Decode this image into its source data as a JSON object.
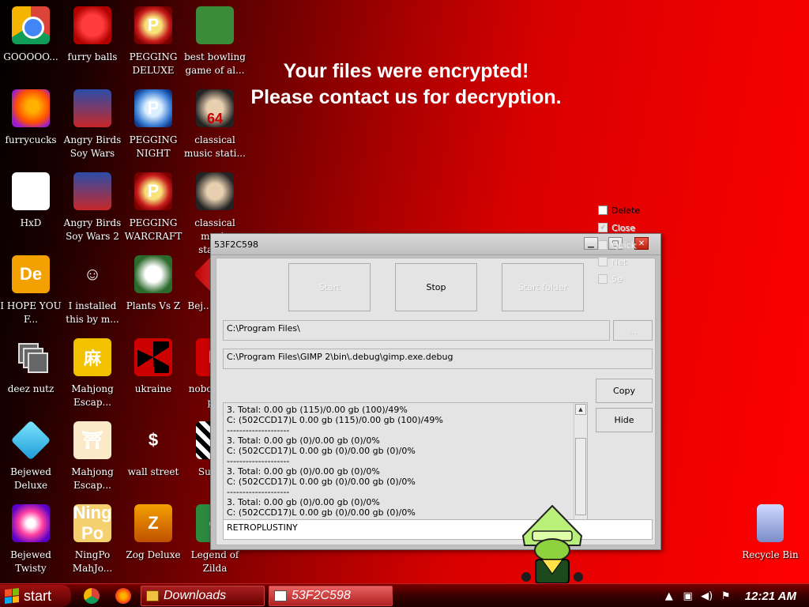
{
  "banner": {
    "line1": "Your files were encrypted!",
    "line2": "Please contact us for decryption."
  },
  "desktop_icons": [
    {
      "label": "GOOOOO...",
      "icon": "chrome-icon"
    },
    {
      "label": "furry balls",
      "icon": "fuzzy-ball-icon"
    },
    {
      "label": "PEGGING DELUXE",
      "icon": "pegging-icon",
      "glyph": "P"
    },
    {
      "label": "best bowling game of al...",
      "icon": "bowling-icon"
    },
    {
      "label": "furrycucks",
      "icon": "firefox-icon"
    },
    {
      "label": "Angry Birds Soy Wars",
      "icon": "angry-birds-icon"
    },
    {
      "label": "PEGGING NIGHT",
      "icon": "pegging-icon",
      "glyph": "P"
    },
    {
      "label": "classical music stati...",
      "icon": "portrait-icon",
      "glyph": "64"
    },
    {
      "label": "HxD",
      "icon": "hxd-icon",
      "glyph": "HxD"
    },
    {
      "label": "Angry Birds Soy Wars 2",
      "icon": "angry-birds-icon"
    },
    {
      "label": "PEGGING WARCRAFT",
      "icon": "pegging-icon",
      "glyph": "P"
    },
    {
      "label": "classical music station",
      "icon": "portrait-icon"
    },
    {
      "label": "I HOPE YOU F...",
      "icon": "de-icon",
      "glyph": "De"
    },
    {
      "label": "I installed this by m...",
      "icon": "running-man-icon",
      "glyph": "☺"
    },
    {
      "label": "Plants Vs Z",
      "icon": "flower-icon"
    },
    {
      "label": "Bej... The...",
      "icon": "jewel-icon"
    },
    {
      "label": "deez nutz",
      "icon": "windows-stack-icon"
    },
    {
      "label": "Mahjong Escap...",
      "icon": "mahjong-icon",
      "glyph": "麻"
    },
    {
      "label": "ukraine",
      "icon": "radiation-icon"
    },
    {
      "label": "nobo... can p...",
      "icon": "nobody-icon",
      "glyph": "D"
    },
    {
      "label": "Bejewed Deluxe",
      "icon": "diamond-icon"
    },
    {
      "label": "Mahjong Escap...",
      "icon": "torii-icon",
      "glyph": "⛩"
    },
    {
      "label": "wall street",
      "icon": "money-bag-icon",
      "glyph": "$"
    },
    {
      "label": "Supe...",
      "icon": "checker-icon"
    },
    {
      "label": "Bejewed Twisty",
      "icon": "twisty-gem-icon"
    },
    {
      "label": "NingPo MahJo...",
      "icon": "ningpo-icon",
      "glyph": "Ning Po"
    },
    {
      "label": "Zog Deluxe",
      "icon": "zog-icon",
      "glyph": "Z"
    },
    {
      "label": "Legend of Zilda",
      "icon": "link-icon",
      "glyph": "☻"
    }
  ],
  "recycle_bin": {
    "label": "Recycle Bin",
    "icon": "recycle-bin-icon"
  },
  "window": {
    "title": "53F2C598",
    "buttons": {
      "start": "Start",
      "stop": "Stop",
      "start_folder": "Start folder"
    },
    "path_field": "C:\\Program Files\\",
    "browse_label": "...",
    "current_file": "C:\\Program Files\\GIMP 2\\bin\\.debug\\gimp.exe.debug",
    "log_lines": [
      "3. Total: 0.00 gb (115)/0.00 gb (100)/49%",
      "C: (502CCD17)L 0.00 gb (115)/0.00 gb (100)/49%",
      "--------------------",
      "3. Total: 0.00 gb (0)/0.00 gb (0)/0%",
      "C: (502CCD17)L 0.00 gb (0)/0.00 gb (0)/0%",
      "--------------------",
      "3. Total: 0.00 gb (0)/0.00 gb (0)/0%",
      "C: (502CCD17)L 0.00 gb (0)/0.00 gb (0)/0%",
      "--------------------",
      "3. Total: 0.00 gb (0)/0.00 gb (0)/0%",
      "C: (502CCD17)L 0.00 gb (0)/0.00 gb (0)/0%"
    ],
    "side_buttons": {
      "copy": "Copy",
      "hide": "Hide"
    },
    "checkboxes": [
      {
        "label": "Delete",
        "enabled": true,
        "checked": false
      },
      {
        "label": "Close",
        "enabled": false,
        "checked": true
      },
      {
        "label": "Quick",
        "enabled": false,
        "checked": false
      },
      {
        "label": "Net",
        "enabled": false,
        "checked": false
      },
      {
        "label": "5e",
        "enabled": false,
        "checked": false
      }
    ],
    "footer_field": "RETROPLUSTINY"
  },
  "taskbar": {
    "start_label": "start",
    "quick_launch": [
      "chrome-icon",
      "firefox-icon"
    ],
    "tasks": [
      {
        "label": "Downloads",
        "icon": "folder-icon"
      },
      {
        "label": "53F2C598",
        "icon": "window-icon"
      }
    ],
    "clock": "12:21 AM"
  },
  "colors": {
    "wallpaper_dark": "#000000",
    "wallpaper_red": "#ff0000",
    "window_bg": "#e4e4e4",
    "taskbar": "#3a0000"
  }
}
